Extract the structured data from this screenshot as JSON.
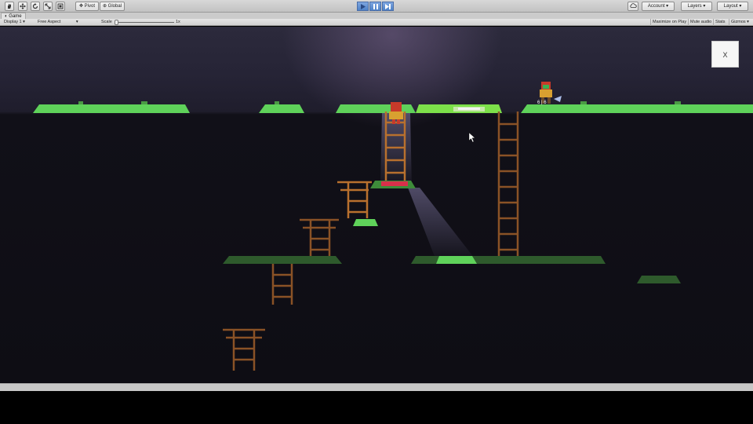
{
  "toolbar": {
    "pivot_label": "Pivot",
    "global_label": "Global",
    "account_label": "Account",
    "layers_label": "Layers",
    "layout_label": "Layout"
  },
  "tab": {
    "title": "Game"
  },
  "viewbar": {
    "display_label": "Display 1",
    "aspect_label": "Free Aspect",
    "scale_label": "Scale",
    "scale_value": "1x",
    "maximize_label": "Maximize on Play",
    "mute_label": "Mute audio",
    "stats_label": "Stats",
    "gizmos_label": "Gizmos"
  },
  "game": {
    "close_label": "X",
    "player_label": "6 | 6",
    "play_state": "paused"
  },
  "colors": {
    "grass": "#5fd25a",
    "ladder": "#a8612e",
    "sky": "#2c2a3c"
  }
}
